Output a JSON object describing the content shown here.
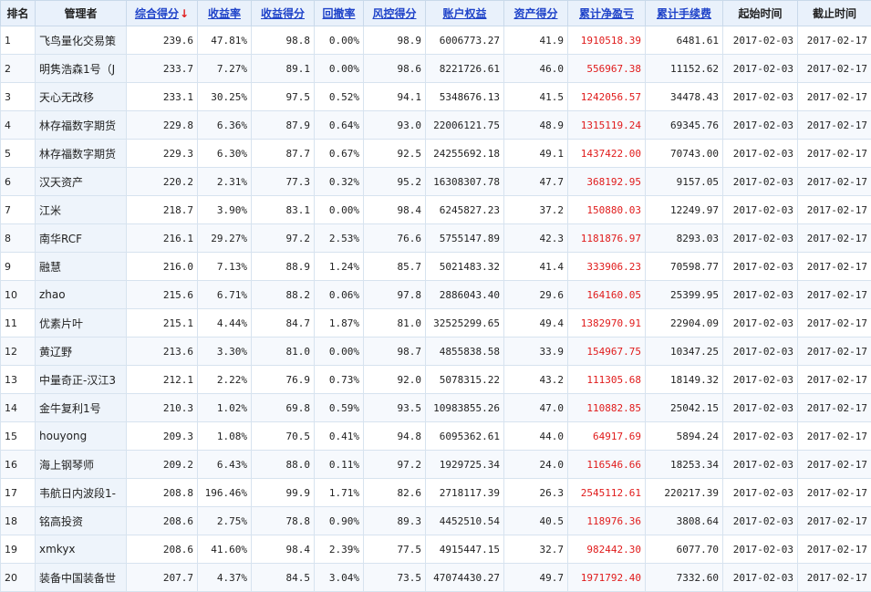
{
  "colors": {
    "header_bg": "#e9f1fb",
    "link": "#1f43c9",
    "profit_red": "#e01b1b",
    "sort_arrow": "#e11d1d"
  },
  "columns": [
    {
      "key": "rank",
      "label": "排名",
      "sortable": false
    },
    {
      "key": "manager",
      "label": "管理者",
      "sortable": false
    },
    {
      "key": "score",
      "label": "综合得分",
      "sortable": true,
      "sorted": "desc",
      "arrow": "↓"
    },
    {
      "key": "return",
      "label": "收益率",
      "sortable": true
    },
    {
      "key": "return_score",
      "label": "收益得分",
      "sortable": true
    },
    {
      "key": "drawdown",
      "label": "回撤率",
      "sortable": true
    },
    {
      "key": "risk_score",
      "label": "风控得分",
      "sortable": true
    },
    {
      "key": "equity",
      "label": "账户权益",
      "sortable": true
    },
    {
      "key": "asset_score",
      "label": "资产得分",
      "sortable": true
    },
    {
      "key": "net_profit",
      "label": "累计净盈亏",
      "sortable": true
    },
    {
      "key": "fees",
      "label": "累计手续费",
      "sortable": true
    },
    {
      "key": "start",
      "label": "起始时间",
      "sortable": false
    },
    {
      "key": "end",
      "label": "截止时间",
      "sortable": false
    }
  ],
  "rows": [
    [
      "1",
      "飞鸟量化交易策",
      "239.6",
      "47.81%",
      "98.8",
      "0.00%",
      "98.9",
      "6006773.27",
      "41.9",
      "1910518.39",
      "6481.61",
      "2017-02-03",
      "2017-02-17"
    ],
    [
      "2",
      "明隽浩森1号（J",
      "233.7",
      "7.27%",
      "89.1",
      "0.00%",
      "98.6",
      "8221726.61",
      "46.0",
      "556967.38",
      "11152.62",
      "2017-02-03",
      "2017-02-17"
    ],
    [
      "3",
      "天心无改移",
      "233.1",
      "30.25%",
      "97.5",
      "0.52%",
      "94.1",
      "5348676.13",
      "41.5",
      "1242056.57",
      "34478.43",
      "2017-02-03",
      "2017-02-17"
    ],
    [
      "4",
      "林存福数字期货",
      "229.8",
      "6.36%",
      "87.9",
      "0.64%",
      "93.0",
      "22006121.75",
      "48.9",
      "1315119.24",
      "69345.76",
      "2017-02-03",
      "2017-02-17"
    ],
    [
      "5",
      "林存福数字期货",
      "229.3",
      "6.30%",
      "87.7",
      "0.67%",
      "92.5",
      "24255692.18",
      "49.1",
      "1437422.00",
      "70743.00",
      "2017-02-03",
      "2017-02-17"
    ],
    [
      "6",
      "汉天资产",
      "220.2",
      "2.31%",
      "77.3",
      "0.32%",
      "95.2",
      "16308307.78",
      "47.7",
      "368192.95",
      "9157.05",
      "2017-02-03",
      "2017-02-17"
    ],
    [
      "7",
      "江米",
      "218.7",
      "3.90%",
      "83.1",
      "0.00%",
      "98.4",
      "6245827.23",
      "37.2",
      "150880.03",
      "12249.97",
      "2017-02-03",
      "2017-02-17"
    ],
    [
      "8",
      "南华RCF",
      "216.1",
      "29.27%",
      "97.2",
      "2.53%",
      "76.6",
      "5755147.89",
      "42.3",
      "1181876.97",
      "8293.03",
      "2017-02-03",
      "2017-02-17"
    ],
    [
      "9",
      "融慧",
      "216.0",
      "7.13%",
      "88.9",
      "1.24%",
      "85.7",
      "5021483.32",
      "41.4",
      "333906.23",
      "70598.77",
      "2017-02-03",
      "2017-02-17"
    ],
    [
      "10",
      "zhao",
      "215.6",
      "6.71%",
      "88.2",
      "0.06%",
      "97.8",
      "2886043.40",
      "29.6",
      "164160.05",
      "25399.95",
      "2017-02-03",
      "2017-02-17"
    ],
    [
      "11",
      "优素片叶",
      "215.1",
      "4.44%",
      "84.7",
      "1.87%",
      "81.0",
      "32525299.65",
      "49.4",
      "1382970.91",
      "22904.09",
      "2017-02-03",
      "2017-02-17"
    ],
    [
      "12",
      "黄辽野",
      "213.6",
      "3.30%",
      "81.0",
      "0.00%",
      "98.7",
      "4855838.58",
      "33.9",
      "154967.75",
      "10347.25",
      "2017-02-03",
      "2017-02-17"
    ],
    [
      "13",
      "中量奇正-汉江3",
      "212.1",
      "2.22%",
      "76.9",
      "0.73%",
      "92.0",
      "5078315.22",
      "43.2",
      "111305.68",
      "18149.32",
      "2017-02-03",
      "2017-02-17"
    ],
    [
      "14",
      "金牛复利1号",
      "210.3",
      "1.02%",
      "69.8",
      "0.59%",
      "93.5",
      "10983855.26",
      "47.0",
      "110882.85",
      "25042.15",
      "2017-02-03",
      "2017-02-17"
    ],
    [
      "15",
      "houyong",
      "209.3",
      "1.08%",
      "70.5",
      "0.41%",
      "94.8",
      "6095362.61",
      "44.0",
      "64917.69",
      "5894.24",
      "2017-02-03",
      "2017-02-17"
    ],
    [
      "16",
      "海上钢琴师",
      "209.2",
      "6.43%",
      "88.0",
      "0.11%",
      "97.2",
      "1929725.34",
      "24.0",
      "116546.66",
      "18253.34",
      "2017-02-03",
      "2017-02-17"
    ],
    [
      "17",
      "韦航日内波段1-",
      "208.8",
      "196.46%",
      "99.9",
      "1.71%",
      "82.6",
      "2718117.39",
      "26.3",
      "2545112.61",
      "220217.39",
      "2017-02-03",
      "2017-02-17"
    ],
    [
      "18",
      "铭高投资",
      "208.6",
      "2.75%",
      "78.8",
      "0.90%",
      "89.3",
      "4452510.54",
      "40.5",
      "118976.36",
      "3808.64",
      "2017-02-03",
      "2017-02-17"
    ],
    [
      "19",
      "xmkyx",
      "208.6",
      "41.60%",
      "98.4",
      "2.39%",
      "77.5",
      "4915447.15",
      "32.7",
      "982442.30",
      "6077.70",
      "2017-02-03",
      "2017-02-17"
    ],
    [
      "20",
      "装备中国装备世",
      "207.7",
      "4.37%",
      "84.5",
      "3.04%",
      "73.5",
      "47074430.27",
      "49.7",
      "1971792.40",
      "7332.60",
      "2017-02-03",
      "2017-02-17"
    ]
  ]
}
